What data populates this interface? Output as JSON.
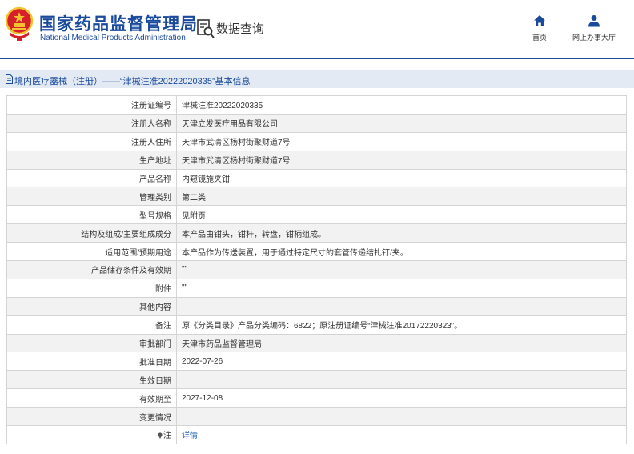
{
  "header": {
    "agency_cn": "国家药品监督管理局",
    "agency_en": "National Medical Products Administration",
    "section": "数据查询",
    "nav": [
      {
        "label": "首页",
        "icon": "home-icon"
      },
      {
        "label": "网上办事大厅",
        "icon": "user-icon"
      }
    ]
  },
  "title": "境内医疗器械（注册）——“津械注准20222020335”基本信息",
  "rows": [
    {
      "label": "注册证编号",
      "value": "津械注准20222020335"
    },
    {
      "label": "注册人名称",
      "value": "天津立发医疗用品有限公司"
    },
    {
      "label": "注册人住所",
      "value": "天津市武清区杨村街聚财道7号"
    },
    {
      "label": "生产地址",
      "value": "天津市武清区杨村街聚财道7号"
    },
    {
      "label": "产品名称",
      "value": "内窥镜施夹钳"
    },
    {
      "label": "管理类别",
      "value": "第二类"
    },
    {
      "label": "型号规格",
      "value": "见附页"
    },
    {
      "label": "结构及组成/主要组成成分",
      "value": "本产品由钳头，钳杆，转盘，钳柄组成。"
    },
    {
      "label": "适用范围/预期用途",
      "value": "本产品作为传送装置，用于通过特定尺寸的套管传递结扎钉/夹。"
    },
    {
      "label": "产品储存条件及有效期",
      "value": "\"\""
    },
    {
      "label": "附件",
      "value": "\"\""
    },
    {
      "label": "其他内容",
      "value": ""
    },
    {
      "label": "备注",
      "value": "原《分类目录》产品分类编码：6822；原注册证编号“津械注准20172220323”。"
    },
    {
      "label": "审批部门",
      "value": "天津市药品监督管理局"
    },
    {
      "label": "批准日期",
      "value": "2022-07-26"
    },
    {
      "label": "生效日期",
      "value": ""
    },
    {
      "label": "有效期至",
      "value": "2027-12-08"
    },
    {
      "label": "变更情况",
      "value": ""
    }
  ],
  "note_row": {
    "label": "注",
    "link": "详情"
  },
  "colors": {
    "brand": "#1a4a9c",
    "link": "#1a5fb4",
    "title_bg": "#e4eaf3",
    "alt_row": "#f2f2f2"
  }
}
